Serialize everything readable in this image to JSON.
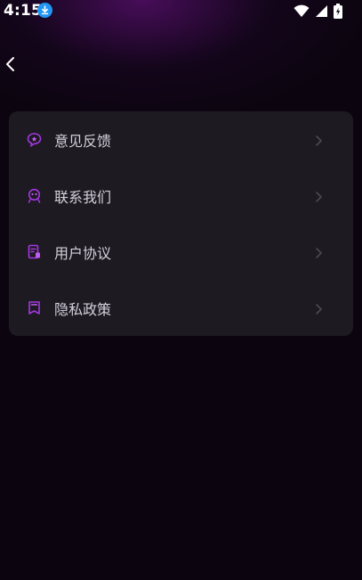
{
  "status_bar": {
    "time": "4:15"
  },
  "icons": {
    "download": "download-icon",
    "wifi": "wifi-icon",
    "signal": "cell-signal-icon",
    "battery": "battery-charging-icon",
    "back": "chevron-left-icon"
  },
  "colors": {
    "accent": "#a437e0",
    "card_bg": "#1d1a22",
    "page_bg": "#0c050f",
    "download_badge": "#2196f3"
  },
  "menu": {
    "items": [
      {
        "label": "意见反馈",
        "icon": "feedback-icon"
      },
      {
        "label": "联系我们",
        "icon": "contact-icon"
      },
      {
        "label": "用户协议",
        "icon": "user-agreement-icon"
      },
      {
        "label": "隐私政策",
        "icon": "privacy-policy-icon"
      }
    ]
  }
}
